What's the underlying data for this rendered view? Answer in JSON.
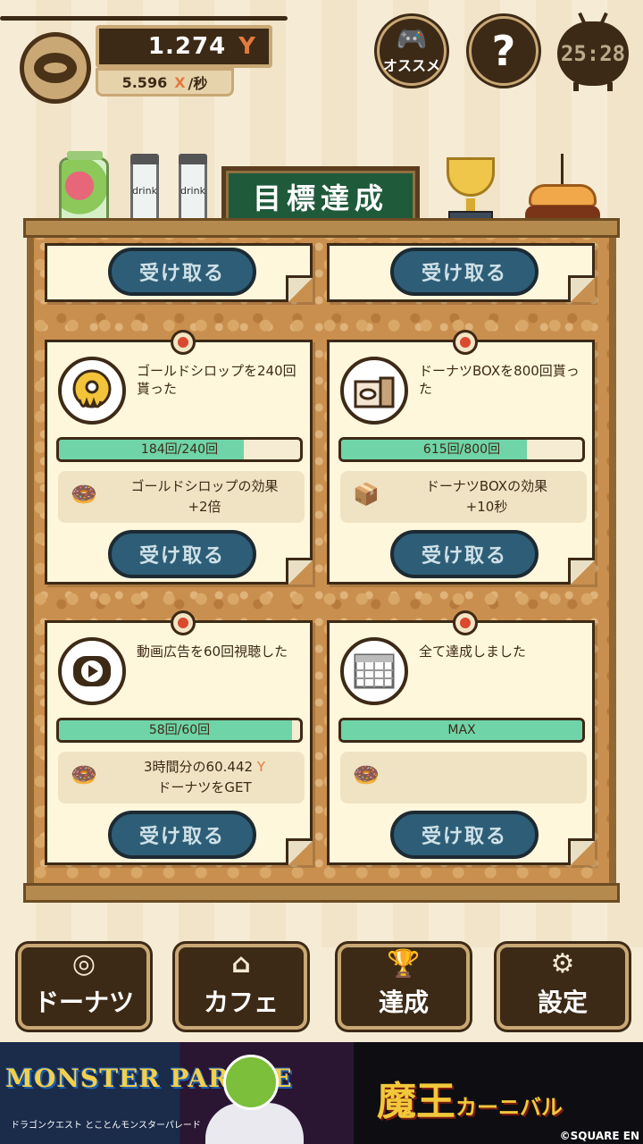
{
  "header": {
    "money_value": "1.274",
    "money_unit": "Y",
    "rate_value": "5.596",
    "rate_unit": "X",
    "rate_suffix": "/秒",
    "osusume_label": "オススメ",
    "help_label": "?",
    "timer": "25:28"
  },
  "shelf": {
    "bottle_label": "drink",
    "sign_title": "目標達成"
  },
  "cards_top": [
    {
      "button": "受け取る"
    },
    {
      "button": "受け取る"
    }
  ],
  "cards": [
    {
      "icon": "gold-syrup-donut-icon",
      "title": "ゴールドシロップを240回貰った",
      "progress_text": "184回/240回",
      "progress_fraction": 0.767,
      "reward_icon": "gold-syrup-upgrade-icon",
      "reward_line1": "ゴールドシロップの効果",
      "reward_line1_unit": "",
      "reward_line2": "+2倍",
      "button": "受け取る"
    },
    {
      "icon": "donut-box-icon",
      "title": "ドーナツBOXを800回貰った",
      "progress_text": "615回/800回",
      "progress_fraction": 0.769,
      "reward_icon": "donut-box-upgrade-icon",
      "reward_line1": "ドーナツBOXの効果",
      "reward_line1_unit": "",
      "reward_line2": "+10秒",
      "button": "受け取る"
    },
    {
      "icon": "video-ad-tv-icon",
      "title": "動画広告を60回視聴した",
      "progress_text": "58回/60回",
      "progress_fraction": 0.967,
      "reward_icon": "donut-tray-icon",
      "reward_line1": "3時間分の60.442",
      "reward_line1_unit": "Y",
      "reward_line2": "ドーナツをGET",
      "button": "受け取る"
    },
    {
      "icon": "calendar-icon",
      "title": "全て達成しました",
      "progress_text": "MAX",
      "progress_fraction": 1.0,
      "reward_icon": "donut-tray-icon",
      "reward_line1": "",
      "reward_line1_unit": "",
      "reward_line2": "",
      "button": "受け取る"
    }
  ],
  "nav": [
    {
      "label": "ドーナツ",
      "icon": "donut-icon"
    },
    {
      "label": "カフェ",
      "icon": "cafe-icon"
    },
    {
      "label": "達成",
      "icon": "trophy-icon"
    },
    {
      "label": "設定",
      "icon": "gear-icon"
    }
  ],
  "ad": {
    "logo": "MONSTER PARADE",
    "sub": "ドラゴンクエスト とことんモンスターパレード",
    "title_main": "魔王",
    "title_sub": "カーニバル",
    "copyright": "©SQUARE EN"
  },
  "colors": {
    "accent_orange": "#e37a3f",
    "progress_green": "#6fd4a8",
    "button_blue": "#2e5e77",
    "board_cork": "#c98f4e",
    "frame_dark": "#3d2a16"
  }
}
